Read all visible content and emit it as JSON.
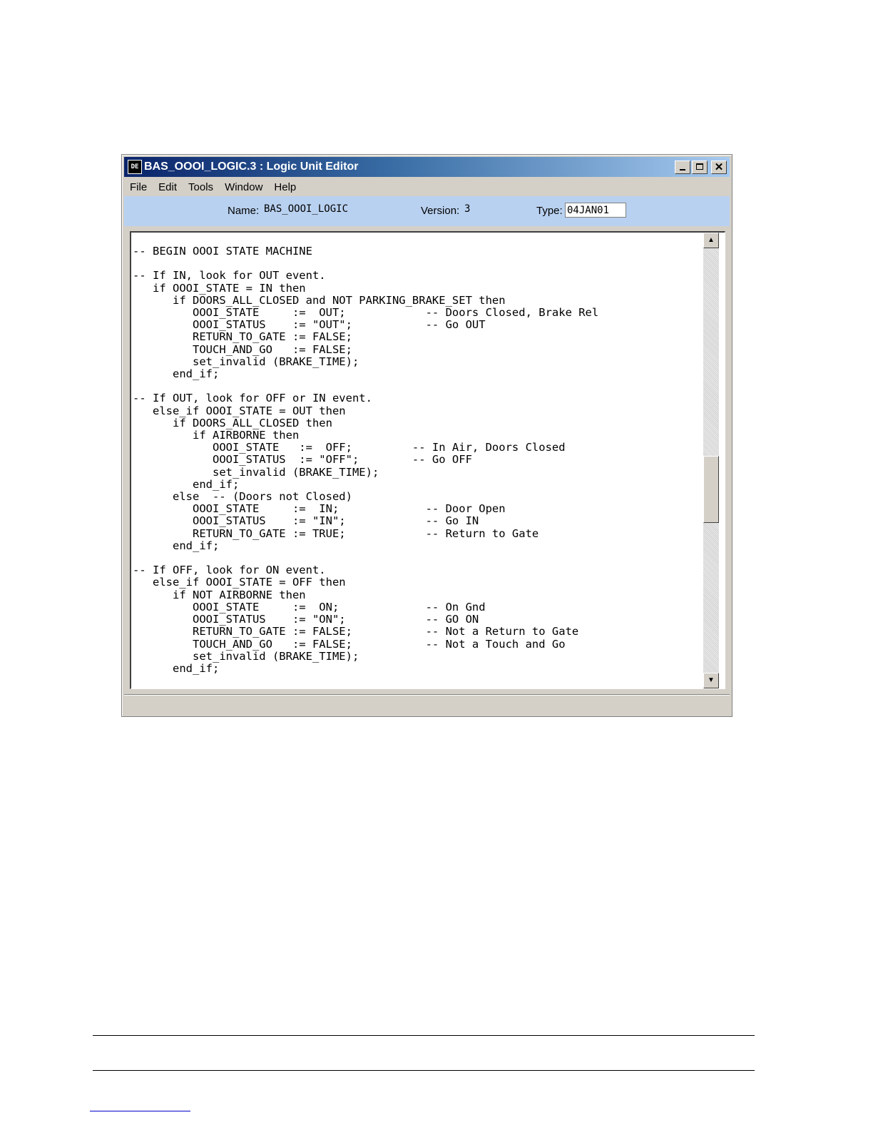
{
  "window": {
    "icon_text": "DE",
    "title": "BAS_OOOI_LOGIC.3 : Logic Unit Editor",
    "buttons": {
      "minimize": "",
      "maximize": "",
      "close": "✕"
    }
  },
  "menu": {
    "items": [
      "File",
      "Edit",
      "Tools",
      "Window",
      "Help"
    ]
  },
  "info": {
    "name_label": "Name:",
    "name_value": "BAS_OOOI_LOGIC",
    "version_label": "Version:",
    "version_value": "3",
    "type_label": "Type:",
    "type_value": "04JAN01"
  },
  "editor": {
    "code": "-- BEGIN OOOI STATE MACHINE\n\n-- If IN, look for OUT event.\n   if OOOI_STATE = IN then\n      if DOORS_ALL_CLOSED and NOT PARKING_BRAKE_SET then\n         OOOI_STATE     :=  OUT;            -- Doors Closed, Brake Rel\n         OOOI_STATUS    := \"OUT\";           -- Go OUT\n         RETURN_TO_GATE := FALSE;\n         TOUCH_AND_GO   := FALSE;\n         set_invalid (BRAKE_TIME);\n      end_if;\n\n-- If OUT, look for OFF or IN event.\n   else_if OOOI_STATE = OUT then\n      if DOORS_ALL_CLOSED then\n         if AIRBORNE then\n            OOOI_STATE   :=  OFF;         -- In Air, Doors Closed\n            OOOI_STATUS  := \"OFF\";        -- Go OFF\n            set_invalid (BRAKE_TIME);\n         end_if;\n      else  -- (Doors not Closed)\n         OOOI_STATE     :=  IN;             -- Door Open\n         OOOI_STATUS    := \"IN\";            -- Go IN\n         RETURN_TO_GATE := TRUE;            -- Return to Gate\n      end_if;\n\n-- If OFF, look for ON event.\n   else_if OOOI_STATE = OFF then\n      if NOT AIRBORNE then\n         OOOI_STATE     :=  ON;             -- On Gnd\n         OOOI_STATUS    := \"ON\";            -- GO ON\n         RETURN_TO_GATE := FALSE;           -- Not a Return to Gate\n         TOUCH_AND_GO   := FALSE;           -- Not a Touch and Go\n         set_invalid (BRAKE_TIME);\n      end_if;",
    "scroll_position": 0.58
  },
  "scrollbar": {
    "up_arrow": "▲",
    "down_arrow": "▼"
  },
  "colors": {
    "title_gradient_start": "#0a246a",
    "title_gradient_end": "#a6caf0",
    "info_bar": "#b9d1f0",
    "chrome": "#d4d0c8"
  }
}
